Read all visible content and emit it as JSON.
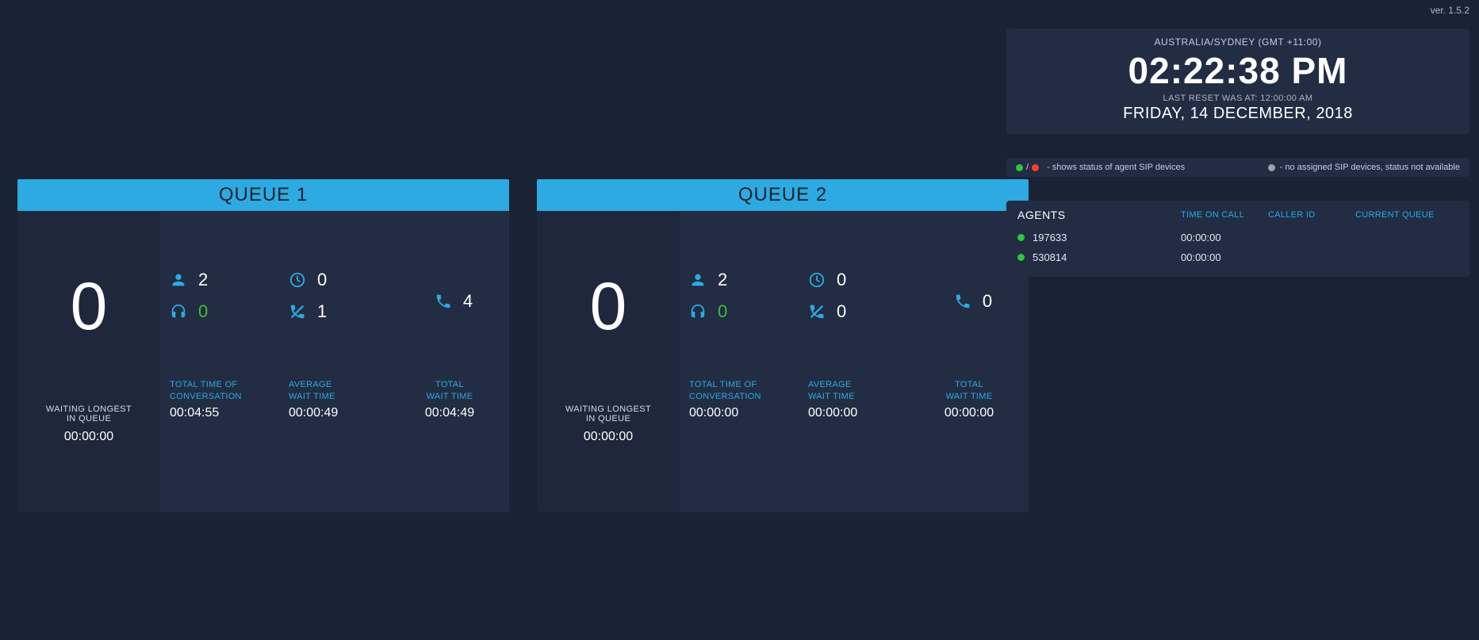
{
  "version": "ver. 1.5.2",
  "clock": {
    "tz": "AUSTRALIA/SYDNEY (GMT +11:00)",
    "time": "02:22:38 PM",
    "reset": "LAST RESET WAS AT: 12:00:00 AM",
    "date": "FRIDAY, 14 DECEMBER, 2018"
  },
  "legend": {
    "status_text": "- shows status of agent SIP devices",
    "none_text": "- no assigned SIP devices, status not available"
  },
  "agents_panel": {
    "title": "AGENTS",
    "col_time": "TIME ON CALL",
    "col_caller": "CALLER ID",
    "col_queue": "CURRENT QUEUE",
    "rows": [
      {
        "id": "197633",
        "time": "00:00:00",
        "caller": "",
        "queue": ""
      },
      {
        "id": "530814",
        "time": "00:00:00",
        "caller": "",
        "queue": ""
      }
    ]
  },
  "queues": [
    {
      "title": "QUEUE 1",
      "waiting": "0",
      "wl_label1": "WAITING LONGEST",
      "wl_label2": "IN QUEUE",
      "wl_time": "00:00:00",
      "agents": "2",
      "on_headset": "0",
      "clock_val": "0",
      "missed": "1",
      "calls": "4",
      "m_total_label1": "TOTAL TIME OF",
      "m_total_label2": "CONVERSATION",
      "m_total_val": "00:04:55",
      "m_avg_label1": "AVERAGE",
      "m_avg_label2": "WAIT TIME",
      "m_avg_val": "00:00:49",
      "m_twt_label1": "TOTAL",
      "m_twt_label2": "WAIT TIME",
      "m_twt_val": "00:04:49"
    },
    {
      "title": "QUEUE 2",
      "waiting": "0",
      "wl_label1": "WAITING LONGEST",
      "wl_label2": "IN QUEUE",
      "wl_time": "00:00:00",
      "agents": "2",
      "on_headset": "0",
      "clock_val": "0",
      "missed": "0",
      "calls": "0",
      "m_total_label1": "TOTAL TIME OF",
      "m_total_label2": "CONVERSATION",
      "m_total_val": "00:00:00",
      "m_avg_label1": "AVERAGE",
      "m_avg_label2": "WAIT TIME",
      "m_avg_val": "00:00:00",
      "m_twt_label1": "TOTAL",
      "m_twt_label2": "WAIT TIME",
      "m_twt_val": "00:00:00"
    }
  ]
}
